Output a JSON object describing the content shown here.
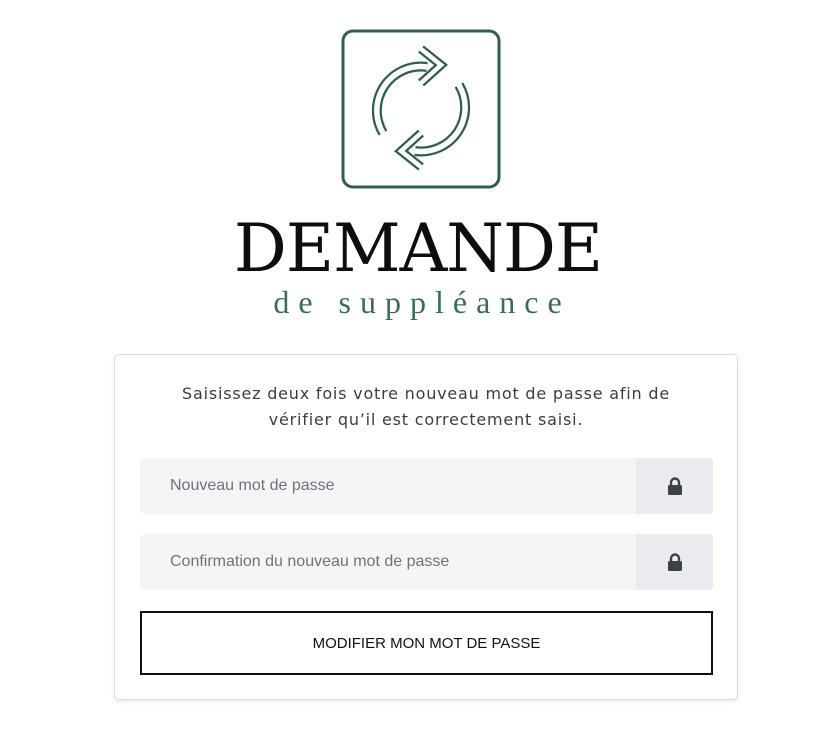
{
  "brand": {
    "title": "DEMANDE",
    "subtitle": "de suppléance",
    "logo_icon": "refresh-arrows-icon",
    "accent_color": "#2f5f48"
  },
  "form": {
    "instructions": "Saisissez deux fois votre nouveau mot de passe afin de vérifier qu’il est correctement saisi.",
    "new_password": {
      "placeholder": "Nouveau mot de passe",
      "value": "",
      "icon": "lock-icon"
    },
    "confirm_password": {
      "placeholder": "Confirmation du nouveau mot de passe",
      "value": "",
      "icon": "lock-icon"
    },
    "submit_label": "MODIFIER MON MOT DE PASSE"
  }
}
